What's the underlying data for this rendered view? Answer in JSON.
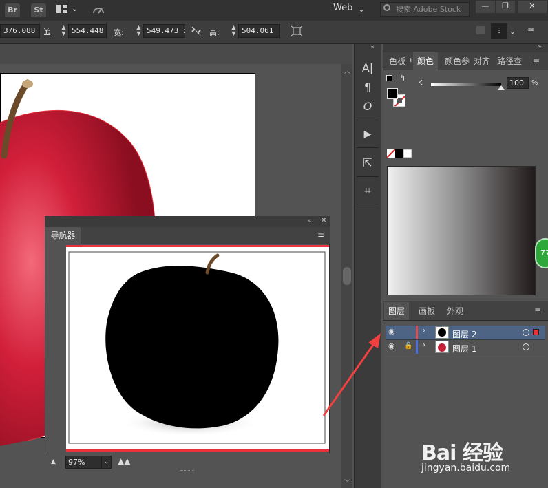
{
  "menubar": {
    "app_icons": [
      "Br",
      "St"
    ],
    "workspace": "Web",
    "stock_search_placeholder": "搜索 Adobe Stock",
    "window_buttons": [
      "minimize-icon",
      "restore-icon",
      "close-icon"
    ]
  },
  "control_bar": {
    "x_value": "376.088 ı",
    "y_label": "Y:",
    "y_value": "554.448 ı",
    "w_label": "宽:",
    "w_value": "549.473 ı",
    "h_label": "高:",
    "h_value": "504.061 ı"
  },
  "color_panel": {
    "tabs": [
      "色板",
      "颜色",
      "颜色参",
      "对齐",
      "路径查"
    ],
    "active_tab": "颜色",
    "channel_label": "K",
    "k_value": "100",
    "k_unit": "%",
    "k_level_percent": 100
  },
  "layers_panel": {
    "tabs": [
      "图层",
      "画板",
      "外观"
    ],
    "active_tab": "图层",
    "layers": [
      {
        "name": "图层 2",
        "selected": true,
        "color": "#e24a4a",
        "locked": false
      },
      {
        "name": "图层 1",
        "selected": false,
        "color": "#4a6fe2",
        "locked": true
      }
    ]
  },
  "navigator": {
    "title": "导航器",
    "zoom": "97%"
  },
  "colors": {
    "accent_red": "#e8323c",
    "selection_blue": "#4d6484"
  },
  "side_badge": "77",
  "watermark": {
    "brand": "Bai 经验",
    "url": "jingyan.baidu.com"
  }
}
